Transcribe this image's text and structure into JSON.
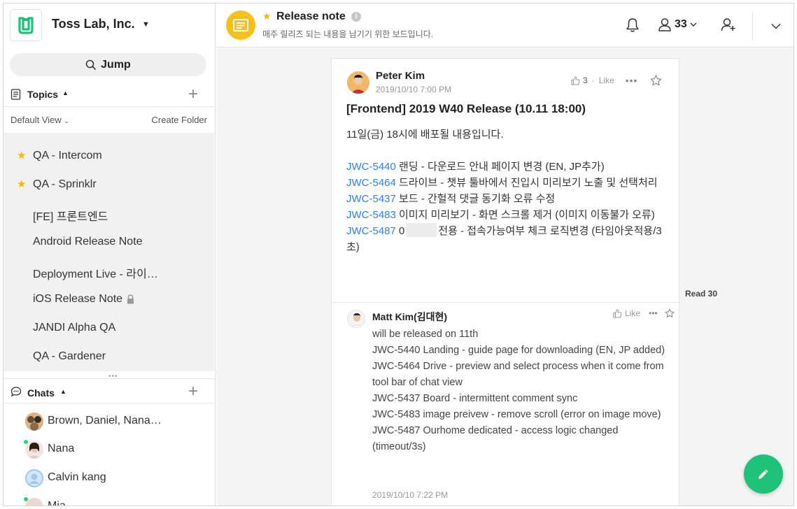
{
  "team": {
    "name": "Toss Lab, Inc."
  },
  "sidebar": {
    "jump_label": "Jump",
    "topics_label": "Topics",
    "default_view": "Default View",
    "create_folder": "Create Folder",
    "topics": [
      {
        "name": "QA - Intercom",
        "starred": true
      },
      {
        "name": "QA - Sprinklr",
        "starred": true
      },
      {
        "name": "[FE] 프론트엔드",
        "starred": false
      },
      {
        "name": "Android Release Note",
        "starred": false
      },
      {
        "name": "Deployment Live - 라이…",
        "starred": false
      },
      {
        "name": "iOS Release Note",
        "starred": false,
        "locked": true
      },
      {
        "name": "JANDI Alpha QA",
        "starred": false
      },
      {
        "name": "QA - Gardener",
        "starred": false
      }
    ],
    "chats_label": "Chats",
    "chats": [
      {
        "name": "Brown, Daniel, Nana…",
        "online": false
      },
      {
        "name": "Nana",
        "online": true
      },
      {
        "name": "Calvin kang",
        "online": false
      },
      {
        "name": "Mia",
        "online": true
      }
    ]
  },
  "header": {
    "title": "Release note",
    "description": "매주 릴리즈 되는 내용을 남기기 위한 보드입니다.",
    "member_count": "33"
  },
  "post": {
    "author": "Peter Kim",
    "timestamp": "2019/10/10 7:00 PM",
    "like_count": "3",
    "like_separator": "·",
    "like_label": "Like",
    "title": "[Frontend] 2019 W40 Release (10.11 18:00)",
    "intro": "11일(금) 18시에 배포될 내용입니다.",
    "items": [
      {
        "key": "JWC-5440",
        "text": " 랜딩 - 다운로드 안내 페이지 변경 (EN, JP추가)"
      },
      {
        "key": "JWC-5464",
        "text": " 드라이브 - 챗뷰 툴바에서 진입시 미리보기 노출 및 선택처리"
      },
      {
        "key": "JWC-5437",
        "text": " 보드 - 간헐적 댓글 동기화 오류 수정"
      },
      {
        "key": "JWC-5483",
        "text": " 이미지 미리보기 - 화면 스크롤 제거 (이미지 이동불가 오류)"
      },
      {
        "key": "JWC-5487",
        "text_before_mask": " 0",
        "text": "전용 - 접속가능여부 체크 로직변경 (타임아웃적용/3초)"
      }
    ],
    "read_label": "Read 30"
  },
  "comment": {
    "author": "Matt Kim(김대현)",
    "like_label": "Like",
    "lines": [
      "will be released on 11th",
      "JWC-5440 Landing - guide page for downloading (EN, JP added)",
      "JWC-5464 Drive - preview and select process when it come from tool bar of chat view",
      "JWC-5437 Board - intermittent comment sync",
      "JWC-5483 image preivew - remove scroll (error on image move)",
      "JWC-5487 Ourhome dedicated - access logic changed (timeout/3s)"
    ],
    "timestamp": "2019/10/10 7:22 PM"
  },
  "colors": {
    "accent": "#1ec279",
    "board": "#f8c01b",
    "link": "#2f80ed",
    "star": "#f5b800",
    "online": "#2ed573"
  },
  "icons": [
    "jandi-logo-icon",
    "search-icon",
    "topics-icon",
    "chat-bubble-icon",
    "star-icon",
    "lock-icon",
    "board-icon",
    "info-icon",
    "bell-icon",
    "member-icon",
    "invite-icon",
    "chevron-down-icon",
    "thumbs-up-icon",
    "more-icon",
    "pencil-icon"
  ]
}
